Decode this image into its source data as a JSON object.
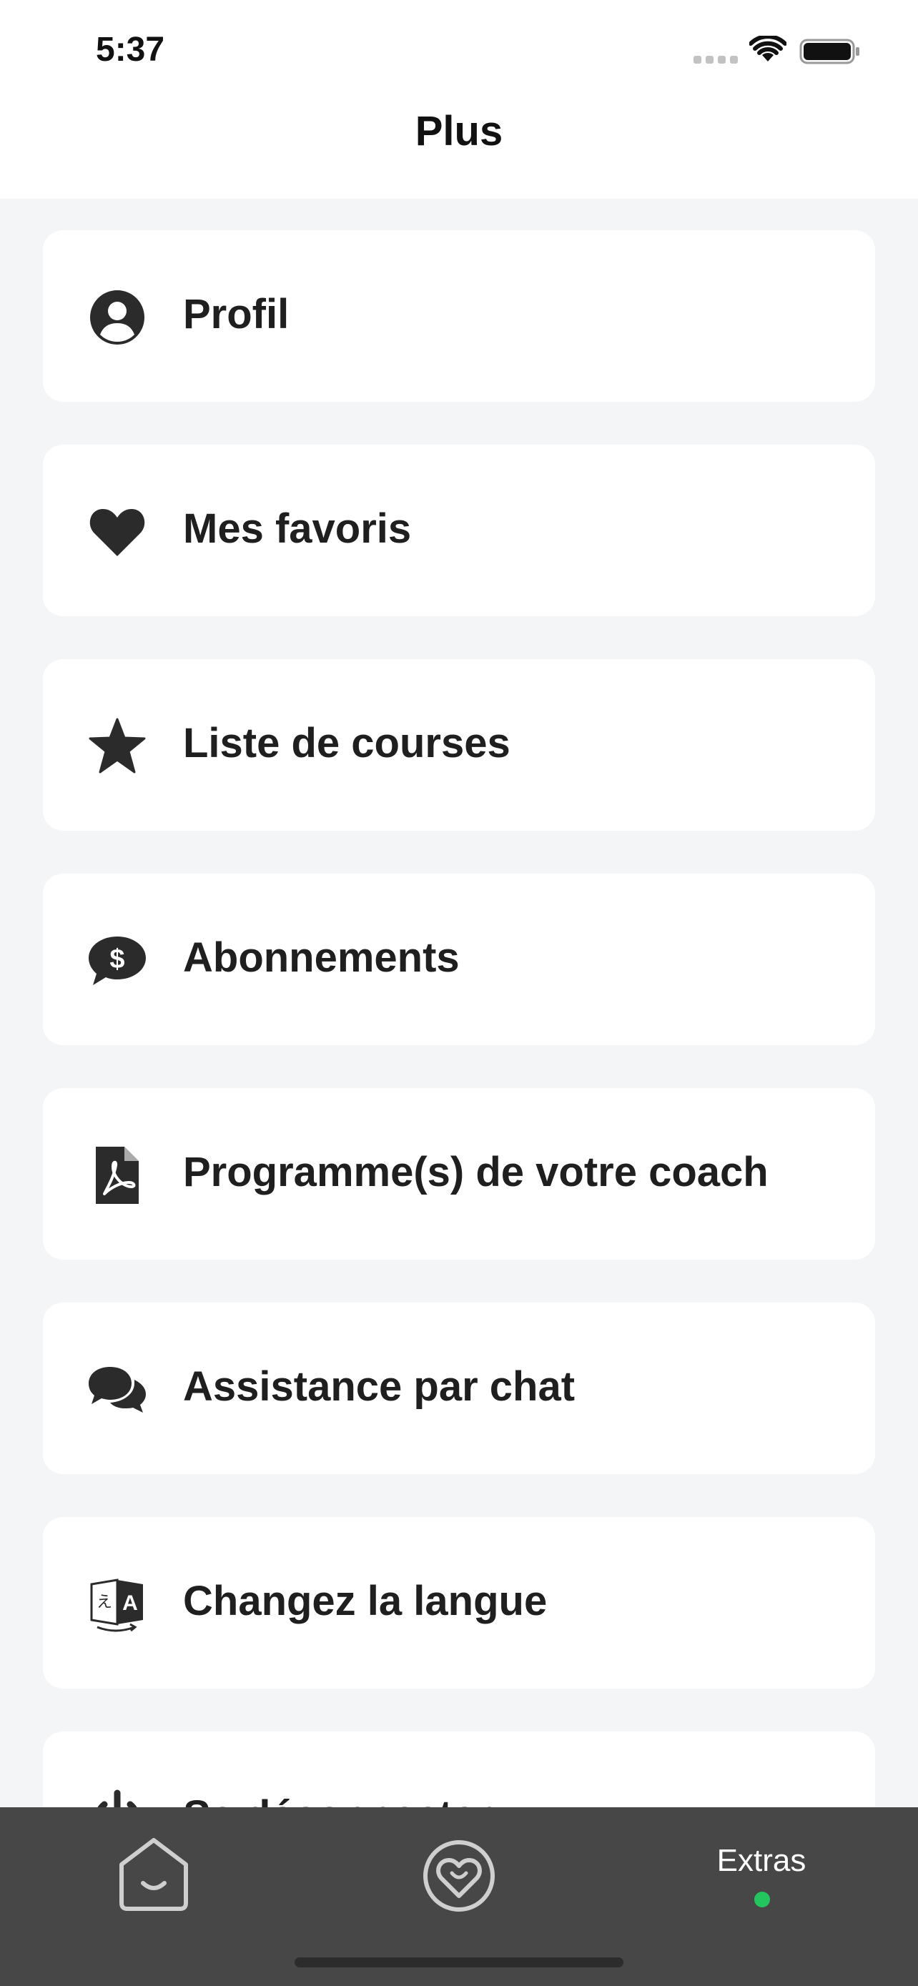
{
  "status_bar": {
    "time": "5:37"
  },
  "nav": {
    "title": "Plus"
  },
  "menu": {
    "items": [
      {
        "label": "Profil",
        "icon": "profile-icon"
      },
      {
        "label": "Mes favoris",
        "icon": "heart-icon"
      },
      {
        "label": "Liste de courses",
        "icon": "star-icon"
      },
      {
        "label": "Abonnements",
        "icon": "dollar-chat-icon"
      },
      {
        "label": "Programme(s) de votre coach",
        "icon": "pdf-file-icon"
      },
      {
        "label": "Assistance par chat",
        "icon": "chat-bubbles-icon"
      },
      {
        "label": "Changez la langue",
        "icon": "translate-icon"
      },
      {
        "label": "Se déconnecter",
        "icon": "power-icon"
      }
    ]
  },
  "tab_bar": {
    "tabs": [
      {
        "icon": "home-icon"
      },
      {
        "icon": "heart-badge-icon"
      },
      {
        "label": "Extras",
        "active": true
      }
    ],
    "active_color": "#22c55e",
    "background": "#474747"
  }
}
